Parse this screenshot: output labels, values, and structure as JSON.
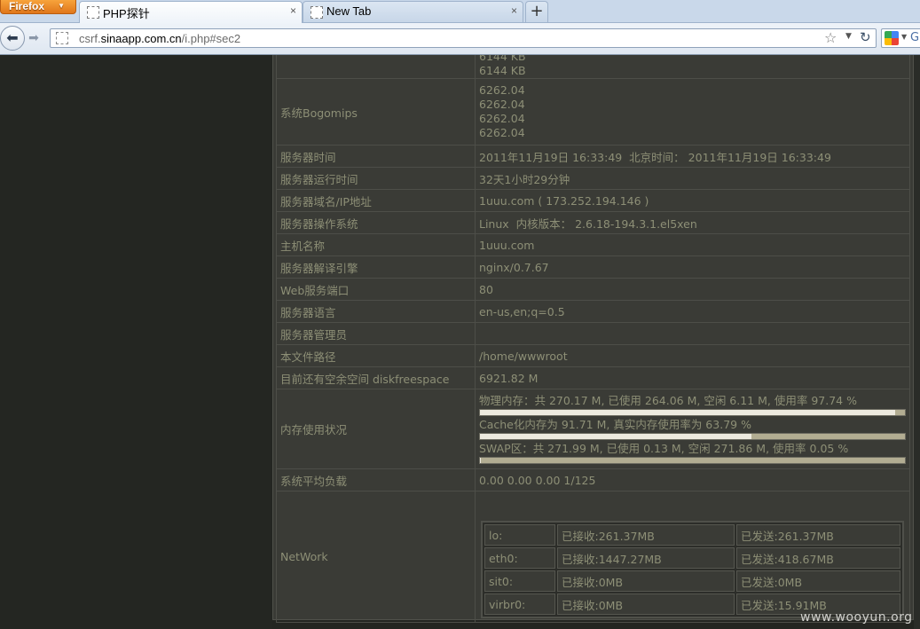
{
  "browser": {
    "menu_button": "Firefox",
    "tabs": [
      {
        "title": "PHP探针",
        "close": "×"
      },
      {
        "title": "New Tab",
        "close": "×"
      }
    ],
    "new_tab": "+",
    "url_prefix": "csrf.",
    "url_domain": "sinaapp.com.cn",
    "url_path": "/i.php#sec2",
    "search_letter": "G"
  },
  "info_rows": {
    "cache_lines": [
      "6144 KB",
      "6144 KB"
    ],
    "bogomips_label": "系统Bogomips",
    "bogomips_values": [
      "6262.04",
      "6262.04",
      "6262.04",
      "6262.04"
    ],
    "rows": [
      {
        "label": "服务器时间",
        "value": "2011年11月19日 16:33:49  北京时间： 2011年11月19日 16:33:49"
      },
      {
        "label": "服务器运行时间",
        "value": "32天1小时29分钟"
      },
      {
        "label": "服务器域名/IP地址",
        "value": "1uuu.com ( 173.252.194.146 )"
      },
      {
        "label": "服务器操作系统",
        "value": "Linux  内核版本： 2.6.18-194.3.1.el5xen"
      },
      {
        "label": "主机名称",
        "value": "1uuu.com"
      },
      {
        "label": "服务器解译引擎",
        "value": "nginx/0.7.67"
      },
      {
        "label": "Web服务端口",
        "value": "80"
      },
      {
        "label": "服务器语言",
        "value": "en-us,en;q=0.5"
      },
      {
        "label": "服务器管理员",
        "value": ""
      },
      {
        "label": "本文件路径",
        "value": "/home/wwwroot"
      },
      {
        "label": "目前还有空余空间 diskfreespace",
        "value": "6921.82 M"
      }
    ],
    "memory_label": "内存使用状况",
    "memory": [
      {
        "text": "物理内存：共 270.17 M, 已使用 264.06 M, 空闲 6.11 M, 使用率 97.74 %",
        "fraction": 0.9774
      },
      {
        "text": "Cache化内存为 91.71 M, 真实内存使用率为 63.79 %",
        "fraction": 0.6379
      },
      {
        "text": "SWAP区：共 271.99 M, 已使用 0.13 M, 空闲 271.86 M, 使用率 0.05 %",
        "fraction": 0.0005
      }
    ],
    "load_label": "系统平均负载",
    "load_value": "0.00 0.00 0.00 1/125",
    "network_label": "NetWork",
    "network": [
      {
        "iface": "lo:",
        "recv": "已接收:261.37MB",
        "sent": "已发送:261.37MB"
      },
      {
        "iface": "eth0:",
        "recv": "已接收:1447.27MB",
        "sent": "已发送:418.67MB"
      },
      {
        "iface": "sit0:",
        "recv": "已接收:0MB",
        "sent": "已发送:0MB"
      },
      {
        "iface": "virbr0:",
        "recv": "已接收:0MB",
        "sent": "已发送:15.91MB"
      }
    ]
  },
  "watermark": "www.wooyun.org",
  "colors": {
    "bar_fill": "#edeadf",
    "bar_track": "#b2ad92",
    "text": "#8d8f76",
    "panel_bg": "#3a3b36"
  }
}
